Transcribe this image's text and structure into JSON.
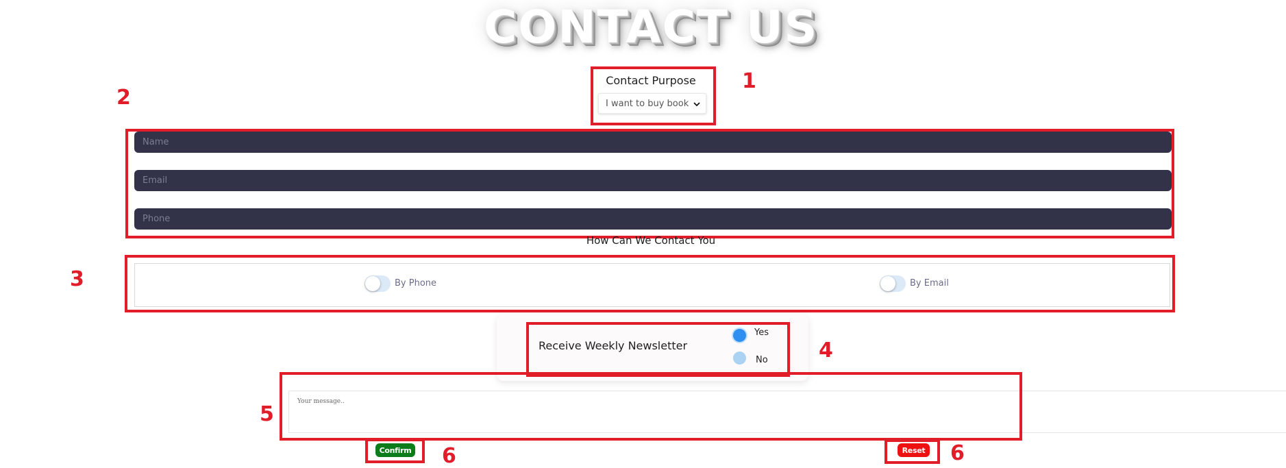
{
  "page": {
    "title": "CONTACT US"
  },
  "purpose": {
    "label": "Contact Purpose",
    "selected": "I want to buy book"
  },
  "fields": {
    "name_placeholder": "Name",
    "email_placeholder": "Email",
    "phone_placeholder": "Phone"
  },
  "contact_method": {
    "heading": "How Can We Contact You",
    "phone_label": "By Phone",
    "email_label": "By Email",
    "phone_enabled": false,
    "email_enabled": false
  },
  "newsletter": {
    "label": "Receive Weekly Newsletter",
    "yes_label": "Yes",
    "no_label": "No",
    "selected": "Yes"
  },
  "message": {
    "placeholder": "Your message.."
  },
  "buttons": {
    "confirm_label": "Confirm",
    "reset_label": "Reset"
  },
  "annotations": {
    "n1": "1",
    "n2": "2",
    "n3": "3",
    "n4": "4",
    "n5": "5",
    "n6a": "6",
    "n6b": "6"
  },
  "colors": {
    "annotation_red": "#e11d2a",
    "input_bg": "#323348",
    "confirm_green": "#0c7d1a",
    "reset_red": "#ee1111",
    "radio_blue": "#2f8ff0"
  }
}
